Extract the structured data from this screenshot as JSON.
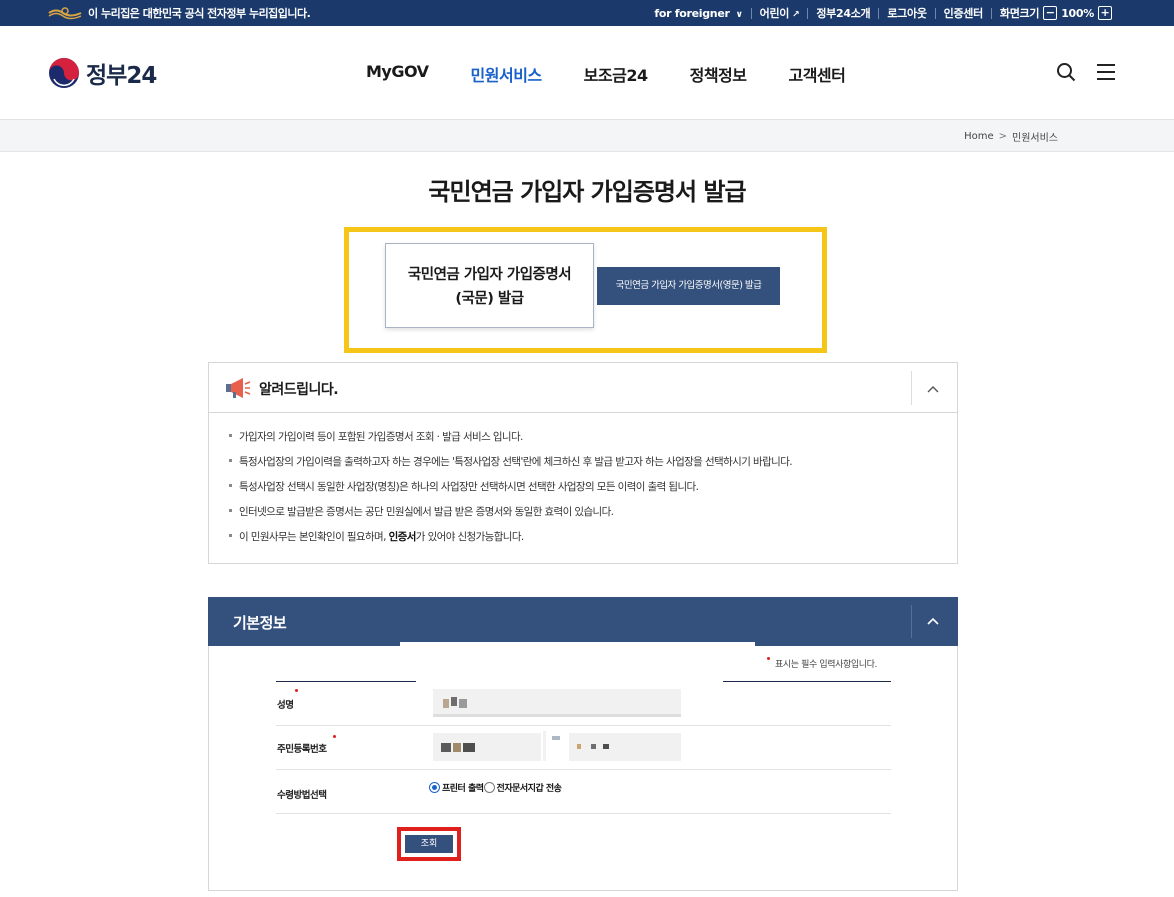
{
  "govbar": {
    "notice": "이 누리집은 대한민국 공식 전자정부 누리집입니다.",
    "for_foreigner": "for foreigner",
    "kids": "어린이",
    "about": "정부24소개",
    "logout": "로그아웃",
    "cert_center": "인증센터",
    "screen_size": "화면크기",
    "zoom_minus": "−",
    "zoom_value": "100%",
    "zoom_plus": "+"
  },
  "header": {
    "brand": "정부24",
    "nav": [
      "MyGOV",
      "민원서비스",
      "보조금24",
      "정책정보",
      "고객센터"
    ],
    "active_nav": "민원서비스"
  },
  "breadcrumb": {
    "home": "Home",
    "arrow": ">",
    "current": "민원서비스"
  },
  "page_title": "국민연금 가입자 가입증명서 발급",
  "choices": {
    "korean_line1": "국민연금 가입자 가입증명서",
    "korean_line2": "(국문) 발급",
    "english": "국민연금 가입자 가입증명서(영문) 발급"
  },
  "notice": {
    "title": "알려드립니다.",
    "items": [
      "가입자의 가입이력 등이 포함된 가입증명서 조회 · 발급 서비스 입니다.",
      "특정사업장의 가입이력을 출력하고자 하는 경우에는 '특정사업장 선택'란에 체크하신 후 발급 받고자 하는 사업장을 선택하시기 바랍니다.",
      "특성사업장 선택시 동일한 사업장(명칭)은 하나의 사업장만 선택하시면 선택한 사업장의 모든 이력이 출력 됩니다.",
      "인터넷으로 발급받은 증명서는 공단 민원실에서 발급 받은 증명서와 동일한 효력이 있습니다."
    ],
    "last_pre": "이 민원사무는 본인확인이 필요하며, ",
    "last_bold": "인증서",
    "last_post": "가 있어야 신청가능합니다."
  },
  "basic_info": {
    "title": "기본정보",
    "required_note": "표시는 필수 입력사항입니다.",
    "name_label": "성명",
    "rrn_label": "주민등록번호",
    "receive_label": "수령방법선택",
    "radio_printer": "프린터 출력",
    "radio_wallet": "전자문서지갑 전송",
    "selected_receive": "프린터 출력",
    "search_button": "조회"
  },
  "colors": {
    "navy": "#1b3a6b",
    "panel_navy": "#34507d",
    "accent_blue": "#1a62c9",
    "highlight_yellow": "#f5c518",
    "highlight_red": "#e0201d"
  },
  "icons": [
    "government-emblem-icon",
    "search-icon",
    "menu-icon",
    "megaphone-icon",
    "chevron-up-icon",
    "external-link-icon"
  ]
}
